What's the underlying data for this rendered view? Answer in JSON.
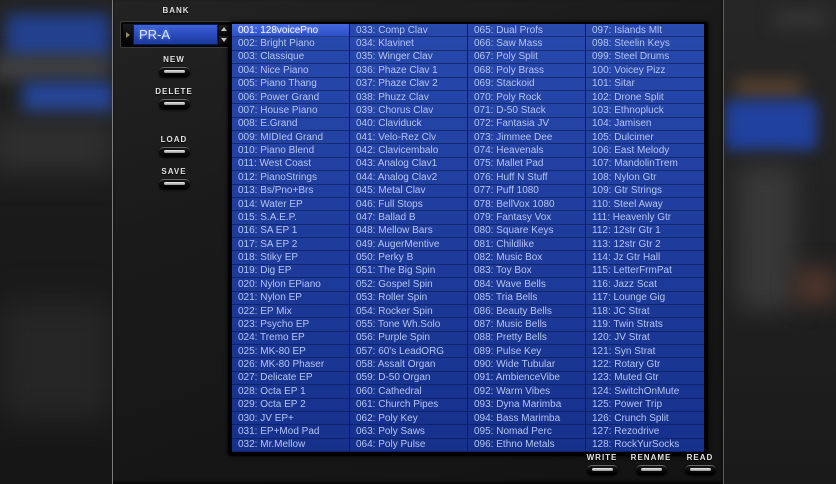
{
  "bank_panel": {
    "label": "BANK",
    "selector": {
      "value": "PR-A"
    },
    "buttons": [
      {
        "label": "NEW"
      },
      {
        "label": "DELETE"
      },
      {
        "label": "LOAD"
      },
      {
        "label": "SAVE"
      }
    ]
  },
  "patch_list": {
    "selected_index": 0,
    "columns": 4,
    "rows_per_column": 32,
    "patches": [
      "128voicePno",
      "Bright Piano",
      "Classique",
      "Nice Piano",
      "Piano Thang",
      "Power Grand",
      "House Piano",
      "E.Grand",
      "MIDIed Grand",
      "Piano Blend",
      "West Coast",
      "PianoStrings",
      "Bs/Pno+Brs",
      "Water EP",
      "S.A.E.P.",
      "SA EP 1",
      "SA EP 2",
      "Stiky EP",
      "Dig EP",
      "Nylon EPiano",
      "Nylon EP",
      "EP Mix",
      "Psycho EP",
      "Tremo EP",
      "MK-80 EP",
      "MK-80 Phaser",
      "Delicate EP",
      "Octa EP 1",
      "Octa EP 2",
      "JV EP+",
      "EP+Mod Pad",
      "Mr.Mellow",
      "Comp Clav",
      "Klavinet",
      "Winger Clav",
      "Phaze Clav 1",
      "Phaze Clav 2",
      "Phuzz Clav",
      "Chorus Clav",
      "Claviduck",
      "Velo-Rez Clv",
      "Clavicembalo",
      "Analog Clav1",
      "Analog Clav2",
      "Metal Clav",
      "Full Stops",
      "Ballad B",
      "Mellow Bars",
      "AugerMentive",
      "Perky B",
      "The Big Spin",
      "Gospel Spin",
      "Roller Spin",
      "Rocker Spin",
      "Tone Wh.Solo",
      "Purple Spin",
      "60's LeadORG",
      "Assalt Organ",
      "D-50 Organ",
      "Cathedral",
      "Church Pipes",
      "Poly Key",
      "Poly Saws",
      "Poly Pulse",
      "Dual Profs",
      "Saw Mass",
      "Poly Split",
      "Poly Brass",
      "Stackoid",
      "Poly Rock",
      "D-50 Stack",
      "Fantasia JV",
      "Jimmee Dee",
      "Heavenals",
      "Mallet Pad",
      "Huff N Stuff",
      "Puff 1080",
      "BellVox 1080",
      "Fantasy Vox",
      "Square Keys",
      "Childlike",
      "Music Box",
      "Toy Box",
      "Wave Bells",
      "Tria Bells",
      "Beauty Bells",
      "Music Bells",
      "Pretty Bells",
      "Pulse Key",
      "Wide Tubular",
      "AmbienceVibe",
      "Warm Vibes",
      "Dyna Marimba",
      "Bass Marimba",
      "Nomad Perc",
      "Ethno Metals",
      "Islands Mlt",
      "Steelin Keys",
      "Steel Drums",
      "Voicey Pizz",
      "Sitar",
      "Drone Split",
      "Ethnopluck",
      "Jamisen",
      "Dulcimer",
      "East Melody",
      "MandolinTrem",
      "Nylon Gtr",
      "Gtr Strings",
      "Steel Away",
      "Heavenly Gtr",
      "12str Gtr 1",
      "12str Gtr 2",
      "Jz Gtr Hall",
      "LetterFrmPat",
      "Jazz Scat",
      "Lounge Gig",
      "JC Strat",
      "Twin Strats",
      "JV Strat",
      "Syn Strat",
      "Rotary Gtr",
      "Muted Gtr",
      "SwitchOnMute",
      "Power Trip",
      "Crunch Split",
      "Rezodrive",
      "RockYurSocks"
    ]
  },
  "action_buttons": [
    {
      "label": "WRITE"
    },
    {
      "label": "RENAME"
    },
    {
      "label": "READ"
    }
  ],
  "colors": {
    "list_blue": "#1e3c9c",
    "list_selected_blue": "#3a5ed4",
    "list_text": "#b7c3ef",
    "lcd_blue": "#2a4cbe",
    "panel_dark": "#181818"
  }
}
